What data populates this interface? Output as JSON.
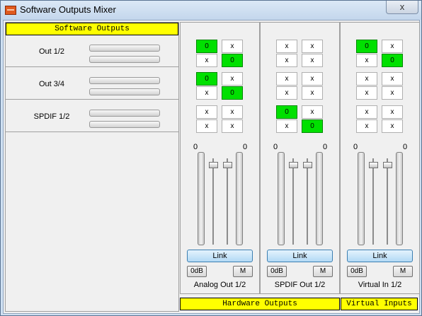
{
  "window": {
    "title": "Software Outputs Mixer",
    "close_glyph": "x"
  },
  "software_outputs": {
    "header": "Software Outputs",
    "rows": [
      {
        "label": "Out 1/2"
      },
      {
        "label": "Out 3/4"
      },
      {
        "label": "SPDIF 1/2"
      }
    ]
  },
  "routing_off_glyph": "x",
  "routing_on_value": "0",
  "strips": [
    {
      "name": "Analog Out 1/2",
      "routing": [
        [
          true,
          false
        ],
        [
          false,
          true
        ],
        [
          true,
          false
        ],
        [
          false,
          true
        ],
        [
          false,
          false
        ],
        [
          false,
          false
        ]
      ],
      "left_value": "0",
      "right_value": "0",
      "link_label": "Link",
      "zero_db_label": "0dB",
      "mute_label": "M"
    },
    {
      "name": "SPDIF Out 1/2",
      "routing": [
        [
          false,
          false
        ],
        [
          false,
          false
        ],
        [
          false,
          false
        ],
        [
          false,
          false
        ],
        [
          true,
          false
        ],
        [
          false,
          true
        ]
      ],
      "left_value": "0",
      "right_value": "0",
      "link_label": "Link",
      "zero_db_label": "0dB",
      "mute_label": "M"
    },
    {
      "name": "Virtual In 1/2",
      "routing": [
        [
          true,
          false
        ],
        [
          false,
          true
        ],
        [
          false,
          false
        ],
        [
          false,
          false
        ],
        [
          false,
          false
        ],
        [
          false,
          false
        ]
      ],
      "left_value": "0",
      "right_value": "0",
      "link_label": "Link",
      "zero_db_label": "0dB",
      "mute_label": "M"
    }
  ],
  "hardware_outputs_header": "Hardware Outputs",
  "virtual_inputs_header": "Virtual Inputs"
}
